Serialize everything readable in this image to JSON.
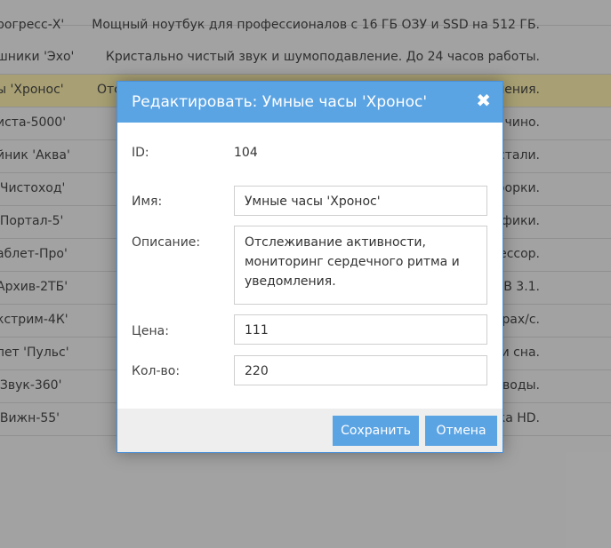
{
  "table": {
    "rows": [
      {
        "name": "рогресс-Х'",
        "desc": "Мощный ноутбук для профессионалов с 16 ГБ ОЗУ и SSD на 512 ГБ.",
        "selected": false
      },
      {
        "name": "шники 'Эхо'",
        "desc": "Кристально чистый звук и шумоподавление. До 24 часов работы.",
        "selected": false
      },
      {
        "name": "ы 'Хронос'",
        "desc": "Отс",
        "selected": true
      },
      {
        "name": "иста-5000'",
        "desc": "чино.",
        "selected": false
      },
      {
        "name": "йник 'Аква'",
        "desc": "стали.",
        "selected": false
      },
      {
        "name": "'Чистоход'",
        "desc": "борки.",
        "selected": false
      },
      {
        "name": "'Портал-5'",
        "desc": "афики.",
        "selected": false
      },
      {
        "name": "аблет-Про'",
        "desc": "ессор.",
        "selected": false
      },
      {
        "name": "Архив-2ТБ'",
        "desc": "SB 3.1.",
        "selected": false
      },
      {
        "name": "кстрим-4К'",
        "desc": "драх/с.",
        "selected": false
      },
      {
        "name": "лет 'Пульс'",
        "desc": "и сна.",
        "selected": false
      },
      {
        "name": "'Звук-360'",
        "desc": "воды.",
        "selected": false
      },
      {
        "name": "'Вижн-55'",
        "desc": "ка HD.",
        "selected": false
      }
    ],
    "selected_row_tail": "ления."
  },
  "modal": {
    "title": "Редактировать: Умные часы 'Хронос'",
    "close_glyph": "✖",
    "id_label": "ID:",
    "id_value": "104",
    "name_label": "Имя:",
    "name_value": "Умные часы 'Хронос'",
    "desc_label": "Описание:",
    "desc_value": "Отслеживание активности, мониторинг сердечного ритма и уведомления.",
    "price_label": "Цена:",
    "price_value": "111",
    "qty_label": "Кол-во:",
    "qty_value": "220",
    "save_label": "Сохранить",
    "cancel_label": "Отмена"
  },
  "colors": {
    "accent": "#5ba4e4",
    "selected_row": "#f1e6a6"
  }
}
